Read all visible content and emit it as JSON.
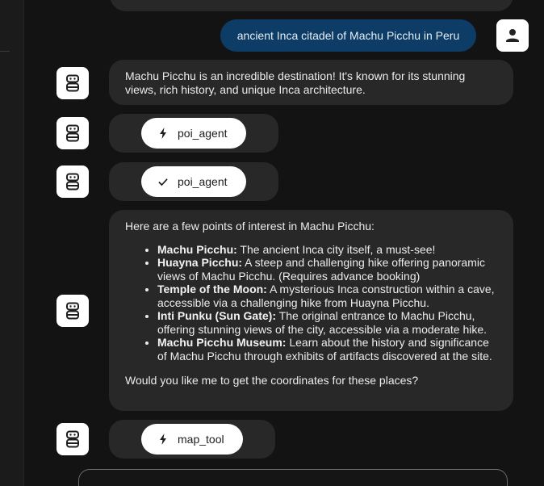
{
  "conversation": {
    "user_message": "ancient Inca citadel of Machu Picchu in Peru",
    "assistant_intro": "Machu Picchu is an incredible destination! It's known for its stunning views, rich history, and unique Inca architecture.",
    "tool_calls": [
      {
        "name": "poi_agent",
        "state": "running",
        "icon": "lightning-icon"
      },
      {
        "name": "poi_agent",
        "state": "done",
        "icon": "check-icon"
      }
    ],
    "poi_response": {
      "intro": "Here are a few points of interest in Machu Picchu:",
      "items": [
        {
          "name": "Machu Picchu:",
          "text": " The ancient Inca city itself, a must-see!"
        },
        {
          "name": "Huayna Picchu:",
          "text": " A steep and challenging hike offering panoramic views of Machu Picchu. (Requires advance booking)"
        },
        {
          "name": "Temple of the Moon:",
          "text": " A mysterious Inca construction within a cave, accessible via a challenging hike from Huayna Picchu."
        },
        {
          "name": "Inti Punku (Sun Gate):",
          "text": " The original entrance to Machu Picchu, offering stunning views of the city, accessible via a moderate hike."
        },
        {
          "name": "Machu Picchu Museum:",
          "text": " Learn about the history and significance of Machu Picchu through exhibits of artifacts discovered at the site."
        }
      ],
      "closing": "Would you like me to get the coordinates for these places?"
    },
    "final_tool_call": {
      "name": "map_tool",
      "state": "running",
      "icon": "lightning-icon"
    }
  },
  "colors": {
    "background": "#131313",
    "assistant_bubble": "#282828",
    "user_bubble": "#0d3d66",
    "pill": "#ffffff"
  }
}
